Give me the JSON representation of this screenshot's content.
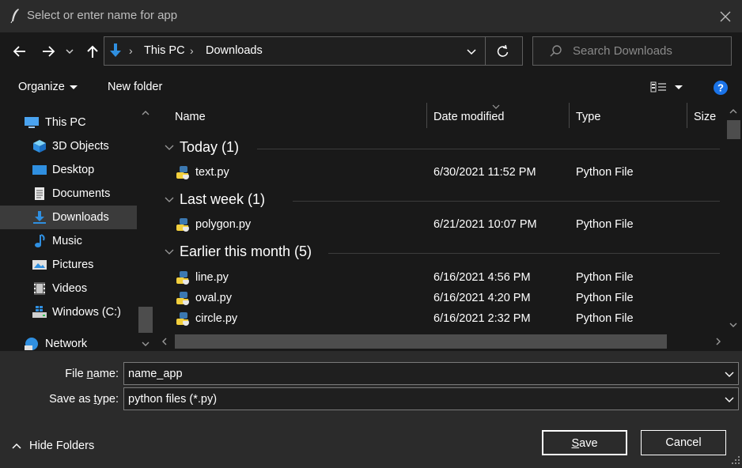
{
  "window": {
    "title": "Select or enter name for app"
  },
  "nav": {
    "breadcrumb": [
      "This PC",
      "Downloads"
    ],
    "search_placeholder": "Search Downloads"
  },
  "toolbar": {
    "organize_label": "Organize",
    "new_folder_label": "New folder"
  },
  "sidebar": {
    "items": [
      {
        "label": "This PC",
        "icon": "this-pc-icon",
        "level": 0
      },
      {
        "label": "3D Objects",
        "icon": "3d-objects-icon",
        "level": 1
      },
      {
        "label": "Desktop",
        "icon": "desktop-icon",
        "level": 1
      },
      {
        "label": "Documents",
        "icon": "documents-icon",
        "level": 1
      },
      {
        "label": "Downloads",
        "icon": "downloads-icon",
        "level": 1,
        "selected": true
      },
      {
        "label": "Music",
        "icon": "music-icon",
        "level": 1
      },
      {
        "label": "Pictures",
        "icon": "pictures-icon",
        "level": 1
      },
      {
        "label": "Videos",
        "icon": "videos-icon",
        "level": 1
      },
      {
        "label": "Windows (C:)",
        "icon": "drive-icon",
        "level": 1
      },
      {
        "label": "Network",
        "icon": "network-icon",
        "level": 0
      }
    ]
  },
  "columns": {
    "name": "Name",
    "date": "Date modified",
    "type": "Type",
    "size": "Size"
  },
  "groups": [
    {
      "label": "Today (1)",
      "files": [
        {
          "name": "text.py",
          "date": "6/30/2021 11:52 PM",
          "type": "Python File"
        }
      ]
    },
    {
      "label": "Last week (1)",
      "files": [
        {
          "name": "polygon.py",
          "date": "6/21/2021 10:07 PM",
          "type": "Python File"
        }
      ]
    },
    {
      "label": "Earlier this month (5)",
      "files": [
        {
          "name": "line.py",
          "date": "6/16/2021 4:56 PM",
          "type": "Python File"
        },
        {
          "name": "oval.py",
          "date": "6/16/2021 4:20 PM",
          "type": "Python File"
        },
        {
          "name": "circle.py",
          "date": "6/16/2021 2:32 PM",
          "type": "Python File"
        }
      ]
    }
  ],
  "form": {
    "file_name_label_pre": "File ",
    "file_name_label_ul": "n",
    "file_name_label_post": "ame:",
    "file_name_value": "name_app",
    "type_label_pre": "Save as ",
    "type_label_ul": "t",
    "type_label_post": "ype:",
    "type_value": "python files (*.py)"
  },
  "footer": {
    "hide_folders_label": "Hide Folders",
    "save_ul": "S",
    "save_rest": "ave",
    "cancel_label": "Cancel"
  },
  "colors": {
    "accent": "#1e90ff",
    "help": "#1a73e8",
    "folder_blue": "#2f8fe0"
  }
}
